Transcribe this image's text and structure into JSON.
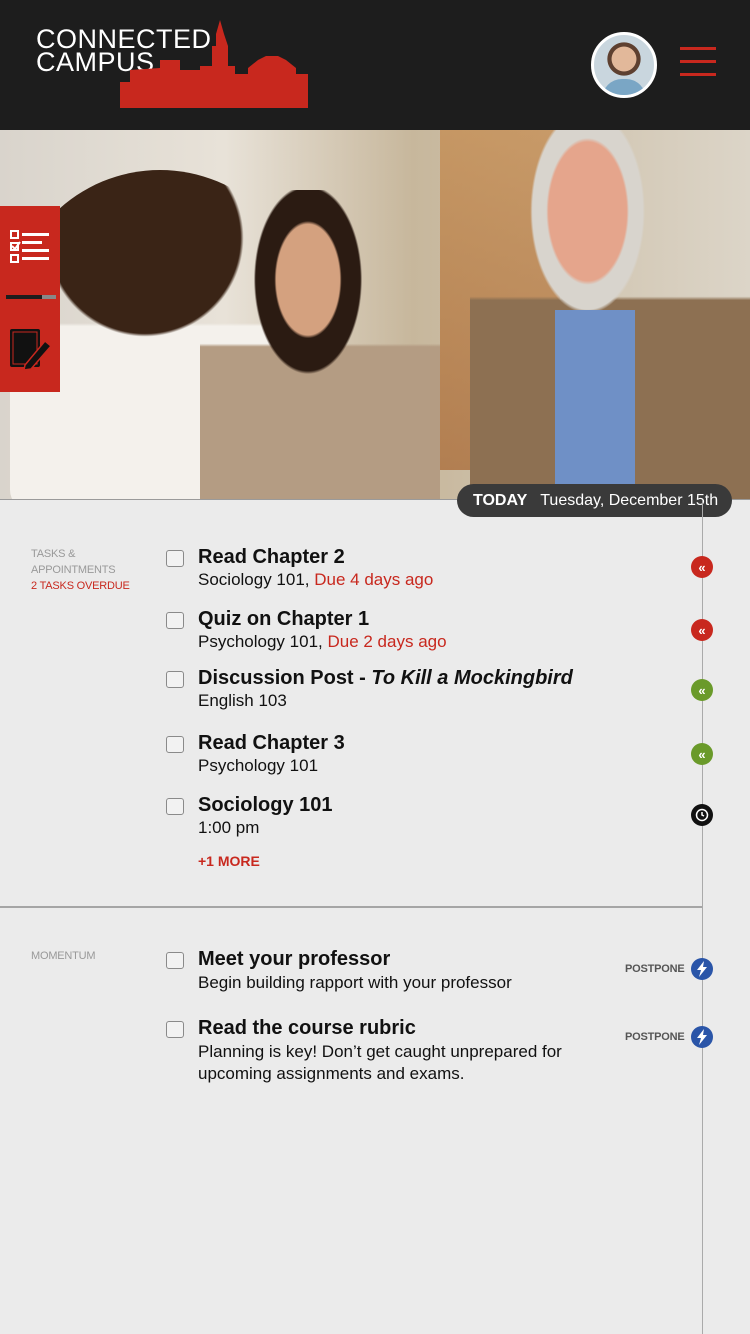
{
  "header": {
    "logo_line1": "CONNECTED",
    "logo_line2": "CAMPUS",
    "brand_color": "#c8281e"
  },
  "date_bar": {
    "today_label": "TODAY",
    "date": "Tuesday, December 15th"
  },
  "tasks": {
    "label_line1": "TASKS &",
    "label_line2": "APPOINTMENTS",
    "overdue_label": "2 TASKS OVERDUE",
    "items": [
      {
        "title": "Read Chapter 2",
        "course": "Sociology 101, ",
        "due": "Due 4 days ago",
        "status": "overdue"
      },
      {
        "title": "Quiz on Chapter 1",
        "course": "Psychology 101, ",
        "due": "Due 2 days ago",
        "status": "overdue"
      },
      {
        "title_prefix": "Discussion Post - ",
        "title_italic": "To Kill a Mockingbird",
        "course": "English 103",
        "status": "pending"
      },
      {
        "title": "Read Chapter 3",
        "course": "Psychology 101",
        "status": "pending"
      },
      {
        "title": "Sociology 101",
        "course": "1:00 pm",
        "status": "appointment"
      }
    ],
    "more_label": "+1 MORE"
  },
  "momentum": {
    "label": "MOMENTUM",
    "postpone_label": "POSTPONE",
    "items": [
      {
        "title": "Meet your professor",
        "desc": "Begin building rapport with your professor"
      },
      {
        "title": "Read the course rubric",
        "desc": "Planning is key! Don’t get caught unprepared for upcoming assignments and exams."
      }
    ]
  },
  "icons": {
    "menu": "hamburger-icon",
    "tasks_tab": "checklist-icon",
    "notes_tab": "notebook-pencil-icon",
    "overdue": "double-chevron-left-icon",
    "appointment": "clock-icon",
    "postpone": "lightning-icon"
  }
}
